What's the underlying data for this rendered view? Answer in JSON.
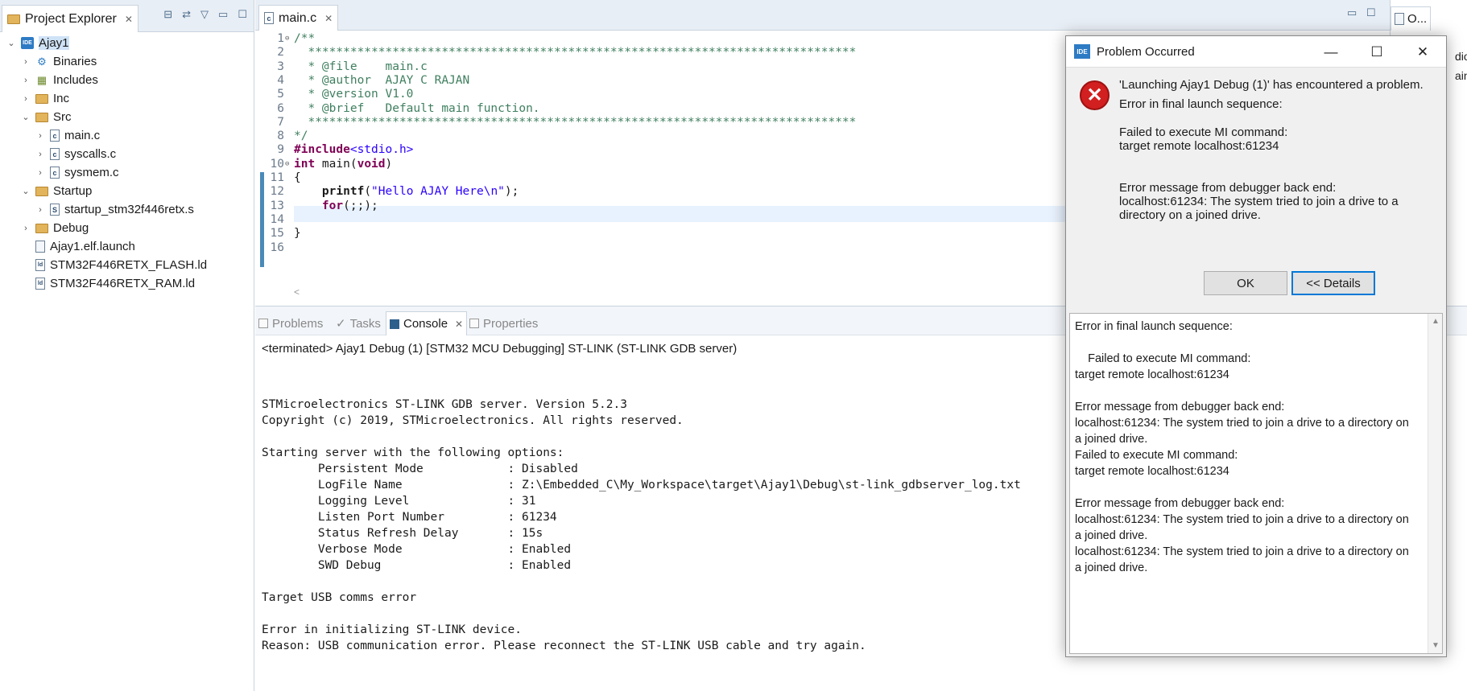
{
  "project_explorer": {
    "tab_label": "Project Explorer",
    "tree": [
      {
        "label": "Ajay1",
        "kind": "project",
        "expanded": true
      },
      {
        "label": "Binaries",
        "kind": "binaries"
      },
      {
        "label": "Includes",
        "kind": "includes"
      },
      {
        "label": "Inc",
        "kind": "folder"
      },
      {
        "label": "Src",
        "kind": "folder",
        "expanded": true
      },
      {
        "label": "main.c",
        "kind": "cfile"
      },
      {
        "label": "syscalls.c",
        "kind": "cfile"
      },
      {
        "label": "sysmem.c",
        "kind": "cfile"
      },
      {
        "label": "Startup",
        "kind": "folder",
        "expanded": true
      },
      {
        "label": "startup_stm32f446retx.s",
        "kind": "sfile"
      },
      {
        "label": "Debug",
        "kind": "folder"
      },
      {
        "label": "Ajay1.elf.launch",
        "kind": "file"
      },
      {
        "label": "STM32F446RETX_FLASH.ld",
        "kind": "ldfile"
      },
      {
        "label": "STM32F446RETX_RAM.ld",
        "kind": "ldfile"
      }
    ]
  },
  "editor": {
    "tab_label": "main.c",
    "lines": [
      {
        "n": "1",
        "text": "/**"
      },
      {
        "n": "2",
        "text": "  ******************************************************************************"
      },
      {
        "n": "3",
        "text": "  * @file    main.c"
      },
      {
        "n": "4",
        "text": "  * @author  AJAY C RAJAN"
      },
      {
        "n": "5",
        "text": "  * @version V1.0"
      },
      {
        "n": "6",
        "text": "  * @brief   Default main function."
      },
      {
        "n": "7",
        "text": "  ******************************************************************************"
      },
      {
        "n": "8",
        "text": "*/"
      },
      {
        "n": "9",
        "text": "#include<stdio.h>"
      },
      {
        "n": "10",
        "text": "int main(void)"
      },
      {
        "n": "11",
        "text": "{"
      },
      {
        "n": "12",
        "text": "    printf(\"Hello AJAY Here\\n\");"
      },
      {
        "n": "13",
        "text": "    for(;;);"
      },
      {
        "n": "14",
        "text": ""
      },
      {
        "n": "15",
        "text": "}"
      },
      {
        "n": "16",
        "text": ""
      }
    ]
  },
  "outline_stub": {
    "tab_label": "O...",
    "partial_lines": [
      "dio.h",
      "ain(v"
    ]
  },
  "console": {
    "tabs": [
      {
        "label": "Problems"
      },
      {
        "label": "Tasks"
      },
      {
        "label": "Console"
      },
      {
        "label": "Properties"
      }
    ],
    "title": "<terminated> Ajay1 Debug (1) [STM32 MCU Debugging] ST-LINK (ST-LINK GDB server)",
    "output": [
      "",
      "STMicroelectronics ST-LINK GDB server. Version 5.2.3",
      "Copyright (c) 2019, STMicroelectronics. All rights reserved.",
      "",
      "Starting server with the following options:",
      "        Persistent Mode            : Disabled",
      "        LogFile Name               : Z:\\Embedded_C\\My_Workspace\\target\\Ajay1\\Debug\\st-link_gdbserver_log.txt",
      "        Logging Level              : 31",
      "        Listen Port Number         : 61234",
      "        Status Refresh Delay       : 15s",
      "        Verbose Mode               : Enabled",
      "        SWD Debug                  : Enabled",
      "",
      "Target USB comms error",
      "",
      "Error in initializing ST-LINK device.",
      "Reason: USB communication error. Please reconnect the ST-LINK USB cable and try again."
    ]
  },
  "dialog": {
    "title": "Problem Occurred",
    "app_icon_text": "IDE",
    "message_lines": [
      "'Launching Ajay1 Debug (1)' has encountered a problem.",
      "Error in final launch sequence:",
      "",
      "Failed to execute MI command:",
      "target remote localhost:61234",
      "",
      "",
      "Error message from debugger back end:",
      "localhost:61234: The system tried to join a drive to a",
      "directory on a joined drive."
    ],
    "ok_label": "OK",
    "details_label": "<< Details",
    "details_lines": [
      "Error in final launch sequence:",
      "",
      "    Failed to execute MI command:",
      "target remote localhost:61234",
      "",
      "Error message from debugger back end:",
      "localhost:61234: The system tried to join a drive to a directory on",
      "a joined drive.",
      "Failed to execute MI command:",
      "target remote localhost:61234",
      "",
      "Error message from debugger back end:",
      "localhost:61234: The system tried to join a drive to a directory on",
      "a joined drive.",
      "localhost:61234: The system tried to join a drive to a directory on",
      "a joined drive."
    ]
  }
}
